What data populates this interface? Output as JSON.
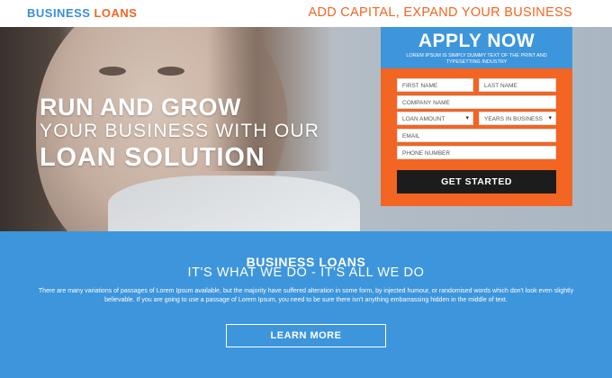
{
  "header": {
    "logo_part1": "BUSINESS",
    "logo_part2": "LOANS",
    "tagline": "ADD CAPITAL, EXPAND YOUR BUSINESS"
  },
  "hero": {
    "line1": "RUN AND GROW",
    "line2": "YOUR BUSINESS WITH OUR",
    "line3": "LOAN SOLUTION"
  },
  "form": {
    "title": "APPLY NOW",
    "subtitle": "LOREM IPSUM IS SIMPLY DUMMY TEXT OF THE PRINT AND TYPESETTING INDUSTRY",
    "first_name_placeholder": "FIRST NAME",
    "last_name_placeholder": "LAST NAME",
    "company_placeholder": "COMPANY NAME",
    "loan_amount_selected": "LOAN AMOUNT",
    "years_selected": "YEARS IN BUSINESS",
    "email_placeholder": "EMAIL",
    "phone_placeholder": "PHONE NUMBER",
    "submit_label": "GET STARTED"
  },
  "info": {
    "title": "BUSINESS LOANS",
    "subtitle": "IT'S WHAT WE DO - IT'S ALL WE DO",
    "body": "There are many variations of passages of Lorem Ipsum available, but the majority have suffered alteration in some form, by injected humour, or randomised words which don't look even slightly believable. If you are going to use a passage of Lorem Ipsum, you need to be sure there isn't anything embarrassing hidden in the middle of text.",
    "button_label": "LEARN MORE"
  },
  "colors": {
    "brand_blue": "#3d95dc",
    "brand_orange": "#f26522",
    "button_dark": "#1c1c1c"
  }
}
